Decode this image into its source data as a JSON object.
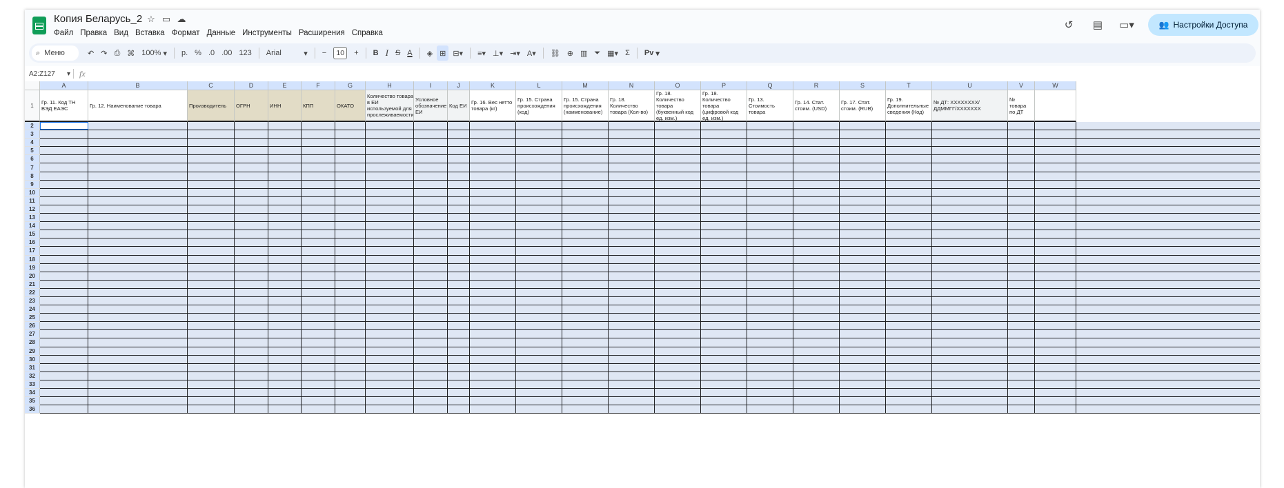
{
  "document": {
    "title": "Копия Беларусь_2"
  },
  "menu": [
    "Файл",
    "Правка",
    "Вид",
    "Вставка",
    "Формат",
    "Данные",
    "Инструменты",
    "Расширения",
    "Справка"
  ],
  "header_right": {
    "share_label": "Настройки Доступа"
  },
  "toolbar": {
    "search_label": "Меню",
    "zoom": "100%",
    "currency": "р.",
    "percent": "%",
    "dec_decrease": ".0",
    "dec_increase": ".00",
    "number_format": "123",
    "font": "Arial",
    "font_size": "10",
    "text_color_letter": "A",
    "input_tools": "Рv"
  },
  "formula": {
    "range": "A2:Z127",
    "fx": "fx"
  },
  "columns": [
    {
      "letter": "A",
      "width": 70,
      "header": "Гр. 11. Код ТН ВЭД ЕАЭС",
      "bg": "#ffffff"
    },
    {
      "letter": "B",
      "width": 144,
      "header": "Гр. 12. Наименование товара",
      "bg": "#ffffff"
    },
    {
      "letter": "C",
      "width": 68,
      "header": "Производитель",
      "bg": "#e2dcc6"
    },
    {
      "letter": "D",
      "width": 49,
      "header": "ОГРН",
      "bg": "#e2dcc6"
    },
    {
      "letter": "E",
      "width": 48,
      "header": "ИНН",
      "bg": "#e2dcc6"
    },
    {
      "letter": "F",
      "width": 49,
      "header": "КПП",
      "bg": "#e2dcc6"
    },
    {
      "letter": "G",
      "width": 44,
      "header": "ОКАТО",
      "bg": "#e2dcc6"
    },
    {
      "letter": "H",
      "width": 70,
      "header": "Количество товара в ЕИ используемой для прослеживаемости",
      "bg": "#f1f3f4"
    },
    {
      "letter": "I",
      "width": 49,
      "header": "Условное обозначение ЕИ",
      "bg": "#f1f3f4"
    },
    {
      "letter": "J",
      "width": 32,
      "header": "Код ЕИ",
      "bg": "#f1f3f4"
    },
    {
      "letter": "K",
      "width": 67,
      "header": "Гр. 16. Вес нетто товара (кг)",
      "bg": "#ffffff"
    },
    {
      "letter": "L",
      "width": 67,
      "header": "Гр. 15. Страна происхождения (код)",
      "bg": "#ffffff"
    },
    {
      "letter": "M",
      "width": 67,
      "header": "Гр. 15. Страна происхождения (наименование)",
      "bg": "#ffffff"
    },
    {
      "letter": "N",
      "width": 67,
      "header": "Гр. 18. Количество товара (Кол-во)",
      "bg": "#ffffff"
    },
    {
      "letter": "O",
      "width": 67,
      "header": "Гр. 18. Количество товара (буквенный код ед. изм.)",
      "bg": "#ffffff"
    },
    {
      "letter": "P",
      "width": 67,
      "header": "Гр. 18. Количество товара (цифровой код ед. изм.)",
      "bg": "#ffffff"
    },
    {
      "letter": "Q",
      "width": 67,
      "header": "Гр. 13. Стоимость товара",
      "bg": "#ffffff"
    },
    {
      "letter": "R",
      "width": 67,
      "header": "Гр. 14. Стат. стоим. (USD)",
      "bg": "#ffffff"
    },
    {
      "letter": "S",
      "width": 67,
      "header": "Гр. 17. Стат. стоим. (RUB)",
      "bg": "#ffffff"
    },
    {
      "letter": "T",
      "width": 67,
      "header": "Гр. 19. Дополнительные сведения (Код)",
      "bg": "#ffffff"
    },
    {
      "letter": "U",
      "width": 110,
      "header": "№ ДТ: XXXXXXXX/ДДММГГ/XXXXXXX",
      "bg": "#f1f3f4"
    },
    {
      "letter": "V",
      "width": 39,
      "header": "№ товара по ДТ",
      "bg": "#ffffff"
    },
    {
      "letter": "W",
      "width": 60,
      "header": "",
      "bg": "#ffffff"
    }
  ],
  "header_row_number": "1",
  "row_numbers": [
    "2",
    "3",
    "4",
    "5",
    "6",
    "7",
    "8",
    "9",
    "10",
    "11",
    "12",
    "13",
    "14",
    "15",
    "16",
    "17",
    "18",
    "19",
    "20",
    "21",
    "22",
    "23",
    "24",
    "25",
    "26",
    "27",
    "28",
    "29",
    "30",
    "31",
    "32",
    "33",
    "34",
    "35",
    "36"
  ]
}
